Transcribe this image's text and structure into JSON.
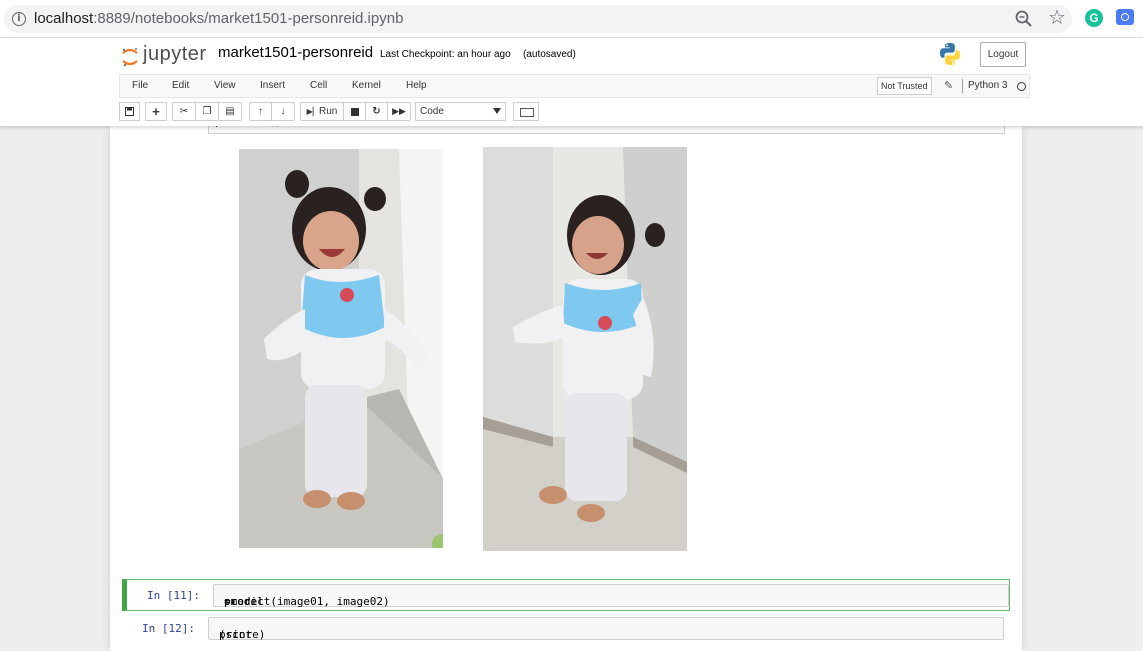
{
  "browser": {
    "url_host": "localhost",
    "url_path": ":8889/notebooks/market1501-personreid.ipynb"
  },
  "header": {
    "logo_text": "jupyter",
    "notebook_name": "market1501-personreid",
    "checkpoint": "Last Checkpoint: an hour ago",
    "autosave": "(autosaved)",
    "logout_label": "Logout"
  },
  "menu": {
    "items": [
      "File",
      "Edit",
      "View",
      "Insert",
      "Cell",
      "Kernel",
      "Help"
    ],
    "trust_label": "Not Trusted",
    "kernel_name": "Python 3"
  },
  "toolbar": {
    "run_label": "Run",
    "cell_type": "Code"
  },
  "cells": [
    {
      "prompt": "In [11]:",
      "code_parts": [
        "score ",
        "=",
        " model",
        ".",
        "predict(image01, image02)"
      ]
    },
    {
      "prompt": "In [12]:",
      "code_parts": [
        "print",
        "(score)"
      ]
    }
  ],
  "output": {
    "images": [
      "child-photo-1",
      "child-photo-2"
    ]
  }
}
